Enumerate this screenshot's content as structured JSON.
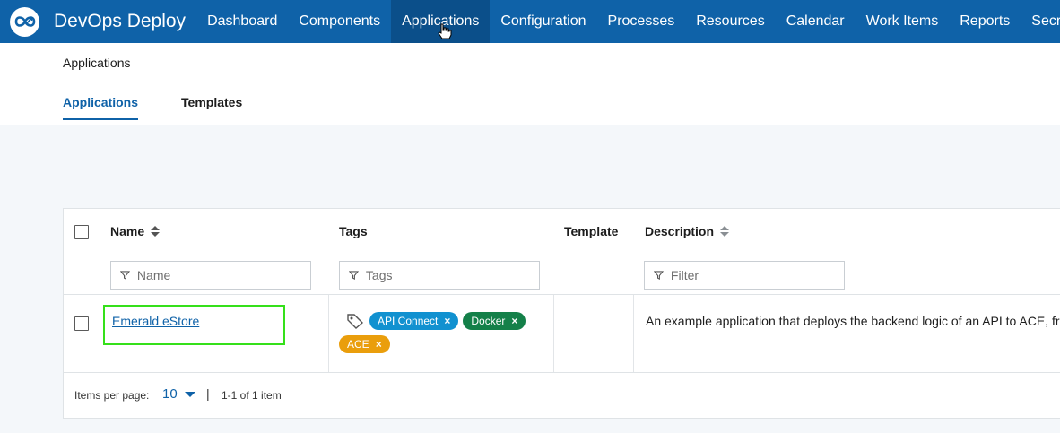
{
  "app": {
    "title": "DevOps Deploy"
  },
  "nav": {
    "items": [
      {
        "label": "Dashboard"
      },
      {
        "label": "Components"
      },
      {
        "label": "Applications",
        "active": true
      },
      {
        "label": "Configuration"
      },
      {
        "label": "Processes"
      },
      {
        "label": "Resources"
      },
      {
        "label": "Calendar"
      },
      {
        "label": "Work Items"
      },
      {
        "label": "Reports"
      },
      {
        "label": "Secret"
      }
    ]
  },
  "breadcrumb": "Applications",
  "tabs": [
    {
      "label": "Applications",
      "active": true
    },
    {
      "label": "Templates"
    }
  ],
  "table": {
    "columns": {
      "name": "Name",
      "tags": "Tags",
      "template": "Template",
      "description": "Description"
    },
    "filters": {
      "name": "Name",
      "tags": "Tags",
      "description": "Filter"
    },
    "rows": [
      {
        "name": "Emerald eStore",
        "tags": [
          {
            "label": "API Connect",
            "color": "#1191d0"
          },
          {
            "label": "Docker",
            "color": "#148049"
          },
          {
            "label": "ACE",
            "color": "#ea9e0c"
          }
        ],
        "template": "",
        "description": "An example application that deploys the backend logic of an API to ACE, fro"
      }
    ],
    "footer": {
      "items_per_page_label": "Items per page:",
      "items_per_page": "10",
      "separator": "|",
      "range": "1-1 of 1 item"
    }
  },
  "colors": {
    "brand": "#0f62a8",
    "highlight": "#35e01a"
  }
}
